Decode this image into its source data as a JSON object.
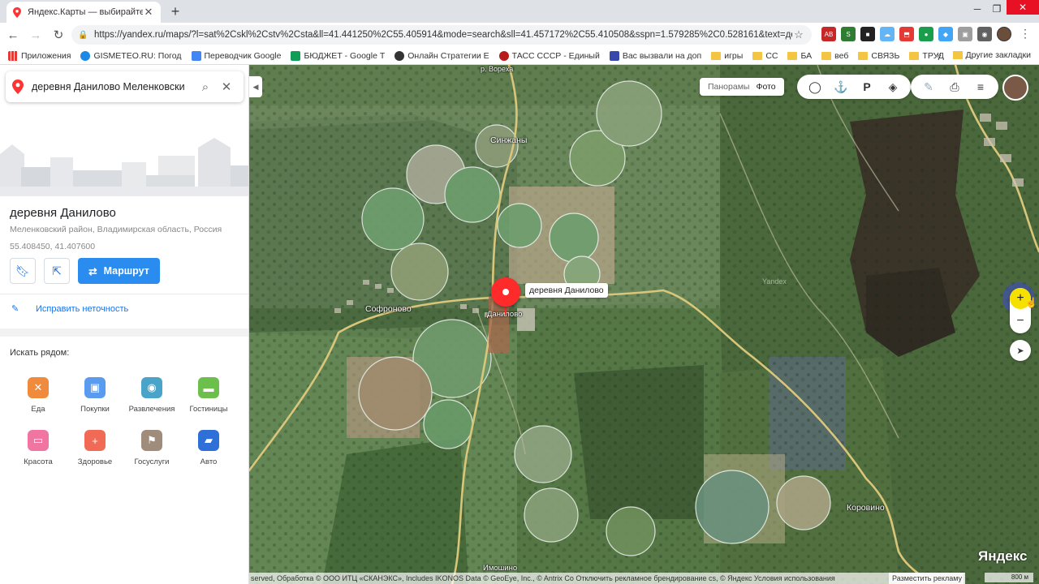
{
  "browser": {
    "tab_title": "Яндекс.Карты — выбирайте, где",
    "url": "https://yandex.ru/maps/?l=sat%2Cskl%2Cstv%2Csta&ll=41.441250%2C55.405914&mode=search&sll=41.457172%2C55.410508&sspn=1.579285%2C0.528161&text=дерев...",
    "bookmarks": [
      "Приложения",
      "GISMETEO.RU: Погод",
      "Переводчик Google",
      "БЮДЖЕТ - Google Т",
      "Онлайн Стратегии Е",
      "ТАСС СССР - Единый",
      "Вас вызвали на доп",
      "игры",
      "СС",
      "БА",
      "веб",
      "СВЯЗЬ",
      "ТРУД"
    ],
    "bookmarks_more": "»",
    "other_bookmarks": "Другие закладки"
  },
  "search": {
    "query": "деревня Данилово Меленковски"
  },
  "place": {
    "name": "деревня Данилово",
    "address": "Меленковский район, Владимирская область, Россия",
    "coords": "55.408450, 41.407600",
    "route_label": "Маршрут",
    "fix_label": "Исправить неточность"
  },
  "nearby": {
    "title": "Искать рядом:",
    "categories": [
      {
        "label": "Еда",
        "icon": "fork-knife-icon",
        "color": "#f08a3c"
      },
      {
        "label": "Покупки",
        "icon": "shopping-bag-icon",
        "color": "#5a9bf0"
      },
      {
        "label": "Развлечения",
        "icon": "camera-icon",
        "color": "#4aa3c8"
      },
      {
        "label": "Гостиницы",
        "icon": "bed-icon",
        "color": "#6cbf4b"
      },
      {
        "label": "Красота",
        "icon": "lipstick-icon",
        "color": "#f075a0"
      },
      {
        "label": "Здоровье",
        "icon": "cross-icon",
        "color": "#f06a55"
      },
      {
        "label": "Госуслуги",
        "icon": "flag-icon",
        "color": "#a08c7a"
      },
      {
        "label": "Авто",
        "icon": "car-icon",
        "color": "#2e6fd8"
      }
    ]
  },
  "map": {
    "layer_panoramas": "Панорамы",
    "layer_photo": "Фото",
    "pin_label": "деревня Данилово",
    "labels": {
      "river": "р. Вореха",
      "sinzhany": "Синжаны",
      "sofronovo": "Софроново",
      "danilovo": "Данилово",
      "korovino": "Коровино",
      "imoshino": "Имошино",
      "yandex_watermark": "Yandex"
    },
    "copyright": "served, Обработка © ООО ИТЦ «СКАНЭКС», Includes IKONOS Data © GeoEye, Inc., © Antrix Co Отключить рекламное брендирование cs, © Яндекс Условия использования",
    "ads_button": "Разместить рекламу",
    "logo": "Яндекс",
    "scale": "800 м"
  }
}
